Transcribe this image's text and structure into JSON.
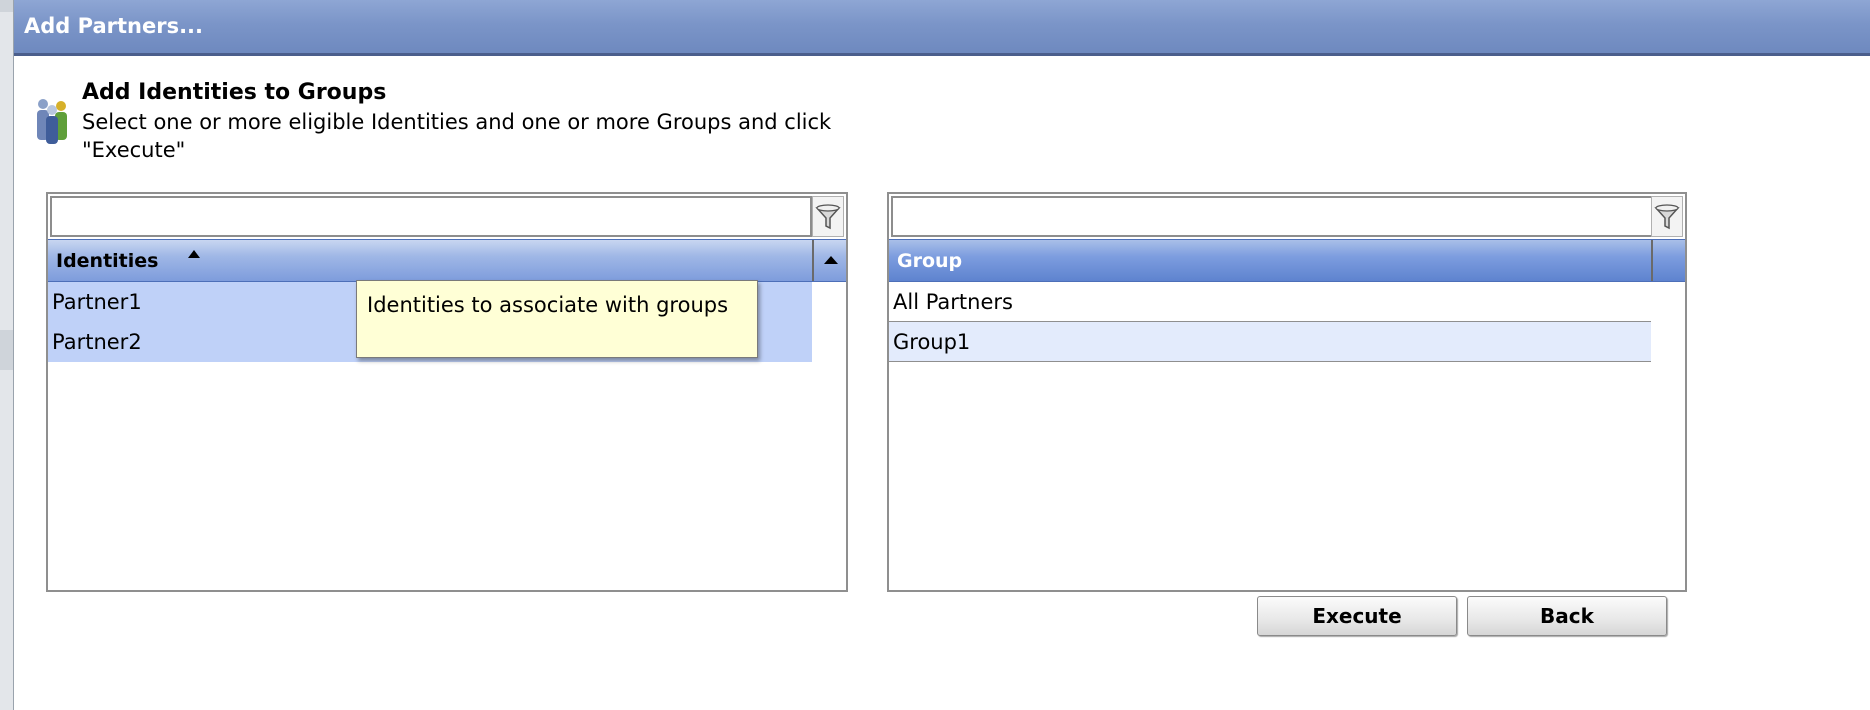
{
  "dialog": {
    "title": "Add Partners..."
  },
  "header": {
    "icon": "people-icon",
    "title": "Add Identities to Groups",
    "description": "Select one or more eligible Identities and one or more Groups and click \"Execute\""
  },
  "identities_panel": {
    "filter_value": "",
    "filter_icon": "funnel-icon",
    "column_header": "Identities",
    "sort": "ascending",
    "rows": [
      "Partner1",
      "Partner2"
    ],
    "selected_rows": [
      "Partner1",
      "Partner2"
    ]
  },
  "groups_panel": {
    "filter_value": "",
    "filter_icon": "funnel-icon",
    "column_header": "Group",
    "rows": [
      "All Partners",
      "Group1"
    ]
  },
  "tooltip": {
    "text": "Identities to associate with groups"
  },
  "actions": {
    "execute_label": "Execute",
    "back_label": "Back"
  },
  "colors": {
    "titlebar": "#7b95c8",
    "header_blue": "#5e83cf",
    "selection": "#bfd1f8",
    "tooltip_bg": "#ffffd6"
  }
}
